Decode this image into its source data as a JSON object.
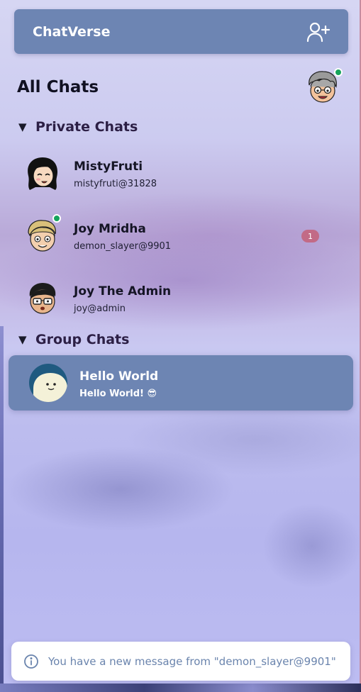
{
  "header": {
    "title": "ChatVerse",
    "add_user_icon": "user-plus-icon"
  },
  "main": {
    "heading": "All Chats",
    "user_status": "online"
  },
  "sections": {
    "private": {
      "title": "Private Chats",
      "caret_icon": "caret-down-icon",
      "items": [
        {
          "name": "MistyFruti",
          "handle": "mistyfruti@31828",
          "online": false,
          "unread": null
        },
        {
          "name": "Joy Mridha",
          "handle": "demon_slayer@9901",
          "online": true,
          "unread": "1"
        },
        {
          "name": "Joy The Admin",
          "handle": "joy@admin",
          "online": false,
          "unread": null
        }
      ]
    },
    "group": {
      "title": "Group Chats",
      "caret_icon": "caret-down-icon",
      "items": [
        {
          "name": "Hello World",
          "last_message": "Hello World! 😎",
          "active": true
        }
      ]
    }
  },
  "toast": {
    "icon": "info-icon",
    "message": "You have a new message from \"demon_slayer@9901\""
  },
  "colors": {
    "accent": "#6d85b3",
    "online": "#16a35c",
    "badge": "#c26a86",
    "toast_text": "#6a84ad"
  }
}
